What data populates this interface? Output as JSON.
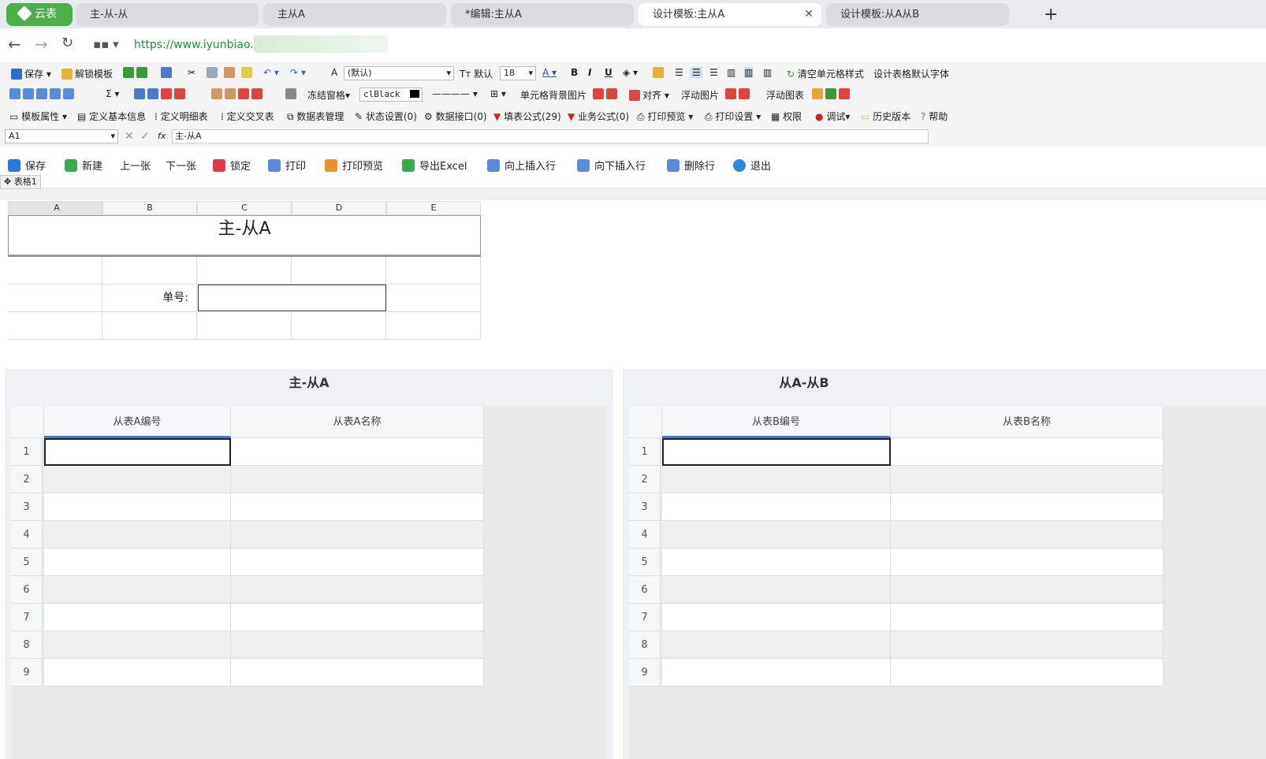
{
  "browser": {
    "logo": "云表",
    "tabs": [
      "主-从-从",
      "主从A",
      "*编辑:主从A",
      "设计模板:主从A",
      "设计模板:从A从B"
    ],
    "url": "https://www.iyunbiao.cn/"
  },
  "toolbar1": {
    "save": "保存",
    "unlock": "解锁模板",
    "font": "(默认)",
    "default_label": "默认",
    "size": "18",
    "bold": "B",
    "italic": "I",
    "underline": "U",
    "clear_style": "清空单元格样式",
    "default_font": "设计表格默认字体"
  },
  "toolbar2": {
    "freeze": "冻结窗格",
    "color": "clBlack",
    "cell_bg": "单元格背景图片",
    "align": "对齐",
    "float_img": "浮动图片",
    "float_chart": "浮动图表",
    "sigma": "Σ"
  },
  "toolbar3": {
    "items": [
      "模板属性",
      "定义基本信息",
      "定义明细表",
      "定义交叉表",
      "数据表管理",
      "状态设置(0)",
      "数据接口(0)",
      "填表公式(29)",
      "业务公式(0)",
      "打印预览",
      "打印设置",
      "权限",
      "调试",
      "历史版本",
      "帮助"
    ]
  },
  "formula": {
    "cell_ref": "A1",
    "fx": "fx",
    "value": "主-从A"
  },
  "actions": [
    "保存",
    "新建",
    "上一张",
    "下一张",
    "锁定",
    "打印",
    "打印预览",
    "导出Excel",
    "向上插入行",
    "向下插入行",
    "删除行",
    "退出"
  ],
  "sheet": {
    "tag": "表格1",
    "columns": [
      "A",
      "B",
      "C",
      "D",
      "E"
    ],
    "title": "主-从A",
    "doc_label": "单号:"
  },
  "panel_left": {
    "title": "主-从A",
    "headers": [
      "从表A编号",
      "从表A名称"
    ]
  },
  "panel_right": {
    "title": "从A-从B",
    "headers": [
      "从表B编号",
      "从表B名称"
    ]
  },
  "rows": [
    "1",
    "2",
    "3",
    "4",
    "5",
    "6",
    "7",
    "8",
    "9"
  ]
}
